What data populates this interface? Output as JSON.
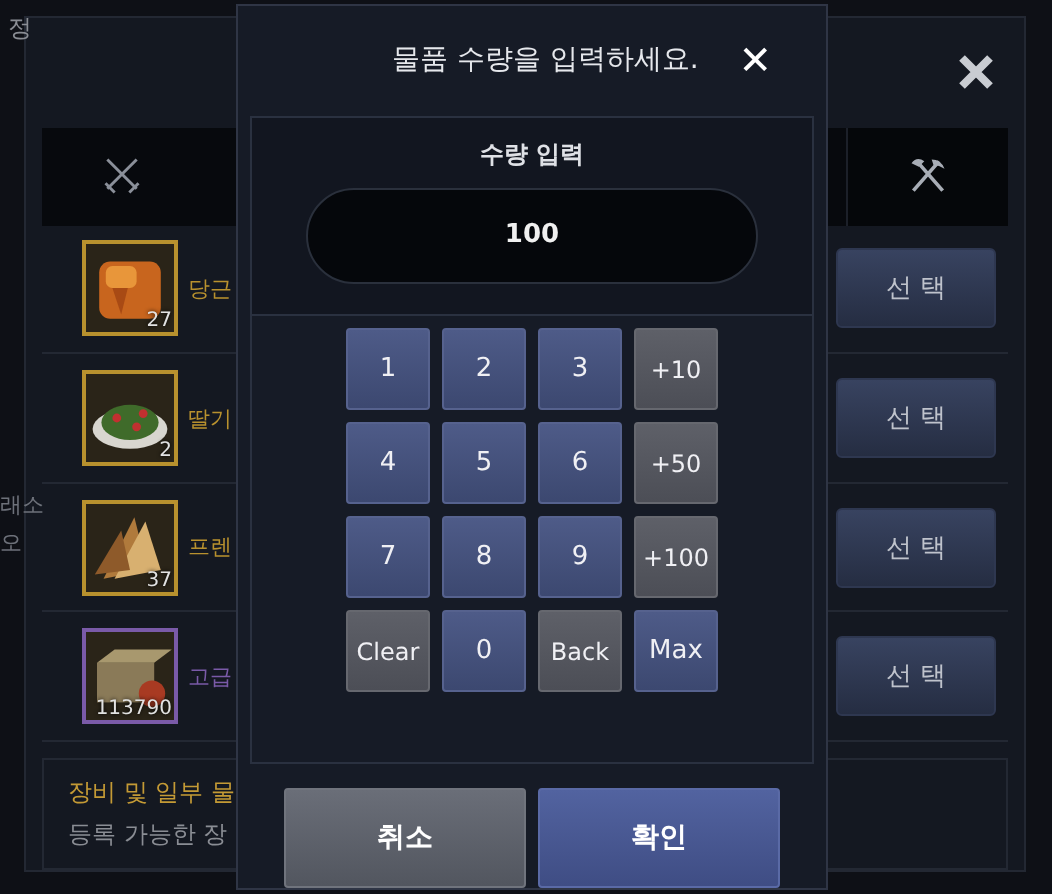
{
  "background": {
    "corner_text": "정",
    "side_texts": [
      "래소",
      "오"
    ],
    "items": [
      {
        "name": "당근",
        "count": "27",
        "kind": "carrot",
        "color": "#b8912e",
        "button": "선 택"
      },
      {
        "name": "딸기",
        "count": "2",
        "kind": "salad",
        "color": "#b8912e",
        "button": "선 택"
      },
      {
        "name": "프렌",
        "count": "37",
        "kind": "toast",
        "color": "#b8912e",
        "button": "선 택"
      },
      {
        "name": "고급",
        "count": "113790",
        "kind": "crate",
        "color": "#7a5aa8",
        "button": "선 택"
      }
    ],
    "notice": [
      {
        "text": "장비 및 일부 물",
        "kind": "warning"
      },
      {
        "text": "등록 가능한 장",
        "kind": "plain"
      }
    ]
  },
  "dialog": {
    "title": "물품 수량을 입력하세요.",
    "close": "✕",
    "input_label": "수량 입력",
    "value": "100",
    "keys": [
      {
        "label": "1",
        "kind": "digit"
      },
      {
        "label": "2",
        "kind": "digit"
      },
      {
        "label": "3",
        "kind": "digit"
      },
      {
        "label": "+10",
        "kind": "step"
      },
      {
        "label": "4",
        "kind": "digit"
      },
      {
        "label": "5",
        "kind": "digit"
      },
      {
        "label": "6",
        "kind": "digit"
      },
      {
        "label": "+50",
        "kind": "step"
      },
      {
        "label": "7",
        "kind": "digit"
      },
      {
        "label": "8",
        "kind": "digit"
      },
      {
        "label": "9",
        "kind": "digit"
      },
      {
        "label": "+100",
        "kind": "step"
      },
      {
        "label": "Clear",
        "kind": "step"
      },
      {
        "label": "0",
        "kind": "digit"
      },
      {
        "label": "Back",
        "kind": "step"
      },
      {
        "label": "Max",
        "kind": "digit"
      }
    ],
    "buttons": [
      {
        "label": "취소",
        "kind": "cancel"
      },
      {
        "label": "확인",
        "kind": "confirm"
      }
    ]
  }
}
